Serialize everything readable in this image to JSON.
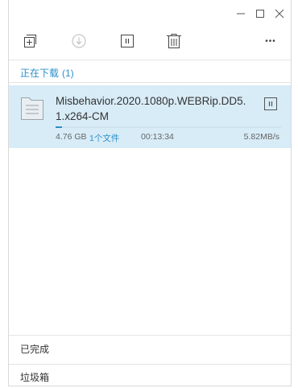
{
  "window": {
    "controls": [
      "minimize",
      "maximize",
      "close"
    ]
  },
  "toolbar": {
    "icons": [
      "add-icon",
      "download-icon",
      "pause-icon",
      "trash-icon",
      "more-icon"
    ],
    "more_label": "•••"
  },
  "downloading": {
    "title": "正在下载",
    "count": "(1)",
    "items": [
      {
        "name": "Misbehavior.2020.1080p.WEBRip.DD5.1.x264-CM",
        "size": "4.76 GB",
        "files": "1个文件",
        "time": "00:13:34",
        "speed": "5.82MB/s",
        "progress": 0.03
      }
    ]
  },
  "colors": {
    "accent": "#2b8fc9",
    "selected_row": "#d8ecf7"
  },
  "footer": {
    "completed": "已完成",
    "trash": "垃圾箱"
  }
}
